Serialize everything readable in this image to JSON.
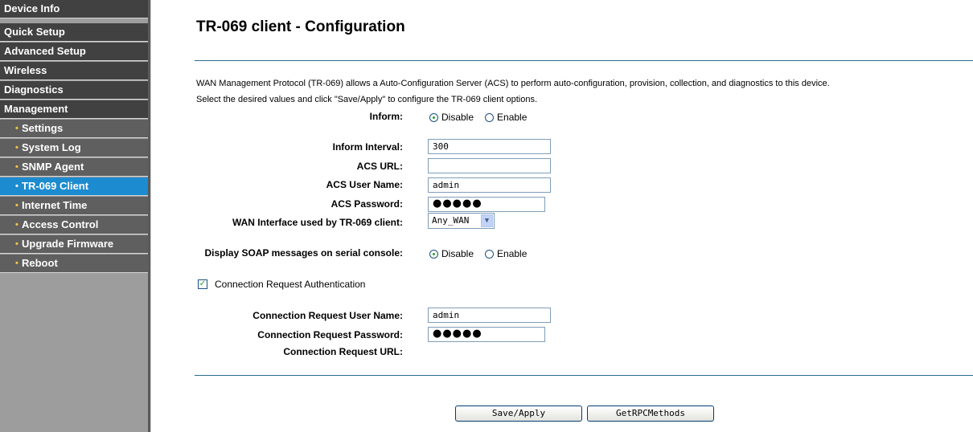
{
  "sidebar": {
    "items": [
      {
        "label": "Device Info"
      },
      {
        "label": "Quick Setup"
      },
      {
        "label": "Advanced Setup"
      },
      {
        "label": "Wireless"
      },
      {
        "label": "Diagnostics"
      },
      {
        "label": "Management"
      },
      {
        "label": "Settings"
      },
      {
        "label": "System Log"
      },
      {
        "label": "SNMP Agent"
      },
      {
        "label": "TR-069 Client"
      },
      {
        "label": "Internet Time"
      },
      {
        "label": "Access Control"
      },
      {
        "label": "Upgrade Firmware"
      },
      {
        "label": "Reboot"
      }
    ],
    "bullet": "•"
  },
  "main": {
    "title": "TR-069 client - Configuration",
    "description_line1": "WAN Management Protocol (TR-069) allows a Auto-Configuration Server (ACS) to perform auto-configuration, provision, collection, and diagnostics to this device.",
    "description_line2": "Select the desired values and click \"Save/Apply\" to configure the TR-069 client options.",
    "inform": {
      "label": "Inform:",
      "option1": "Disable",
      "option2": "Enable",
      "selected": "Disable"
    },
    "inform_interval": {
      "label": "Inform Interval:",
      "value": "300"
    },
    "acs_url": {
      "label": "ACS URL:",
      "value": ""
    },
    "acs_user": {
      "label": "ACS User Name:",
      "value": "admin"
    },
    "acs_password": {
      "label": "ACS Password:",
      "value": "●●●●●"
    },
    "wan_interface": {
      "label": "WAN Interface used by TR-069 client:",
      "value": "Any_WAN",
      "arrow": "▼"
    },
    "soap": {
      "label": "Display SOAP messages on serial console:",
      "option1": "Disable",
      "option2": "Enable",
      "selected": "Disable"
    },
    "conn_auth": {
      "label": "Connection Request Authentication",
      "checked": true,
      "mark": "✓"
    },
    "conn_user": {
      "label": "Connection Request User Name:",
      "value": "admin"
    },
    "conn_password": {
      "label": "Connection Request Password:",
      "value": "●●●●●"
    },
    "conn_url": {
      "label": "Connection Request URL:"
    },
    "buttons": {
      "save": "Save/Apply",
      "rpc": "GetRPCMethods"
    }
  },
  "colors": {
    "sidebar_bg": "#414141",
    "sidebar_active": "#1d8bd0",
    "rule": "#2b6c90",
    "bullet": "#f2c44b"
  }
}
